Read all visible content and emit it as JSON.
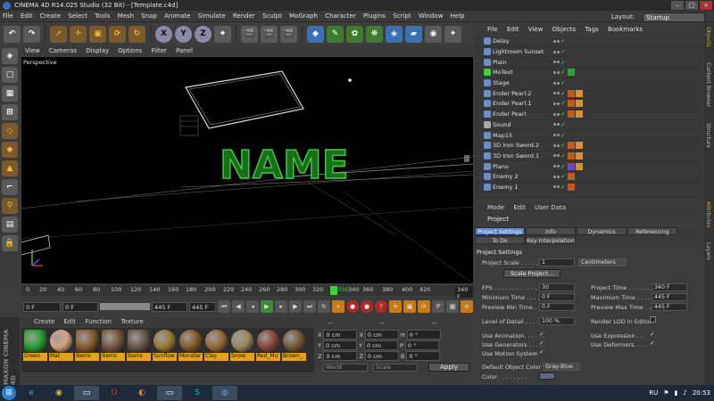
{
  "window": {
    "title": "CINEMA 4D R14.025 Studio (32 Bit) - [Template.c4d]"
  },
  "menu": [
    "File",
    "Edit",
    "Create",
    "Select",
    "Tools",
    "Mesh",
    "Snap",
    "Animate",
    "Simulate",
    "Render",
    "Sculpt",
    "MoGraph",
    "Character",
    "Plugins",
    "Script",
    "Window",
    "Help"
  ],
  "layout": {
    "label": "Layout:",
    "value": "Startup"
  },
  "toolbar": {
    "axes": [
      "X",
      "Y",
      "Z"
    ]
  },
  "viewport": {
    "menu": [
      "View",
      "Cameras",
      "Display",
      "Options",
      "Filter",
      "Panel"
    ],
    "label": "Perspective",
    "text3d": "NAME"
  },
  "timeline": {
    "ticks": [
      "0",
      "20",
      "40",
      "60",
      "80",
      "100",
      "120",
      "140",
      "160",
      "180",
      "200",
      "220",
      "240",
      "260",
      "280",
      "300",
      "320",
      "340",
      "360",
      "380",
      "400",
      "420",
      "440"
    ],
    "current": "330",
    "end_frame": "340 F"
  },
  "transport": {
    "start": "0 F",
    "current_left": "0 F",
    "current_right": "445 F",
    "end": "445 F"
  },
  "materials": {
    "menu": [
      "Create",
      "Edit",
      "Function",
      "Texture"
    ],
    "items": [
      {
        "name": "Green",
        "color": "#2fa22f"
      },
      {
        "name": "Mat",
        "color": "#d8a482"
      },
      {
        "name": "Items",
        "color": "#8a6030"
      },
      {
        "name": "Items",
        "color": "#7a5a40"
      },
      {
        "name": "Items",
        "color": "#6a5a4a"
      },
      {
        "name": "Sunflow",
        "color": "#9a7a30"
      },
      {
        "name": "Monster",
        "color": "#8a5a2a"
      },
      {
        "name": "Clay",
        "color": "#9a6a3a"
      },
      {
        "name": "Snow",
        "color": "#9a8a5a"
      },
      {
        "name": "Red_Mu",
        "color": "#8a4a3a"
      },
      {
        "name": "Brown_",
        "color": "#7a5a3a"
      }
    ]
  },
  "coordinates": {
    "header": [
      "--",
      "--",
      "--"
    ],
    "rows": [
      {
        "a": "X",
        "av": "0 cm",
        "b": "X",
        "bv": "0 cm",
        "c": "H",
        "cv": "0 °"
      },
      {
        "a": "Y",
        "av": "0 cm",
        "b": "Y",
        "bv": "0 cm",
        "c": "P",
        "cv": "0 °"
      },
      {
        "a": "Z",
        "av": "0 cm",
        "b": "Z",
        "bv": "0 cm",
        "c": "B",
        "cv": "0 °"
      }
    ],
    "mode": "World",
    "scale": "Scale",
    "apply": "Apply"
  },
  "objects": {
    "menu": [
      "File",
      "Edit",
      "View",
      "Objects",
      "Tags",
      "Bookmarks"
    ],
    "items": [
      "Delay",
      "Lightroom Sunset",
      "Plain",
      "MoText",
      "Stage",
      "Ender Pearl.2",
      "Ender Pearl.1",
      "Ender Pearl",
      "Sound",
      "Map15",
      "3D Iron Sword.2",
      "3D Iron Sword.1",
      "Plano",
      "Enemy 2",
      "Enemy 1"
    ]
  },
  "attributes": {
    "menu": [
      "Mode",
      "Edit",
      "User Data"
    ],
    "title": "Project",
    "tabs": [
      "Project Settings",
      "Info",
      "Dynamics",
      "Referencing",
      "To Do",
      "Key Interpolation"
    ],
    "section": "Project Settings",
    "scale_label": "Project Scale . . . . . . .",
    "scale_value": "1",
    "scale_unit": "Centimeters",
    "scale_button": "Scale Project...",
    "fps_label": "FPS . . . . . . . . . . . . .",
    "fps": "30",
    "ptime_label": "Project Time . . . . . . .",
    "ptime": "340 F",
    "mintime_label": "Minimum Time . . . . .",
    "mintime": "0 F",
    "maxtime_label": "Maximum Time . . . . .",
    "maxtime": "445 F",
    "pvmin_label": "Preview Min Time . .",
    "pvmin": "0 F",
    "pvmax_label": "Preview Max Time . .",
    "pvmax": "445 F",
    "lod_label": "Level of Detail . . . . .",
    "lod": "100 %",
    "renderlod_label": "Render LOD in Editor",
    "useanim_label": "Use Animation. . . . . .",
    "useexpr_label": "Use Expression . . .",
    "usegen_label": "Use Generators . . . . .",
    "usedef_label": "Use Deformers. . . .",
    "usemo_label": "Use Motion System",
    "defcolor_label": "Default Object Color",
    "defcolor": "Gray-Blue",
    "color_label": "Color . . . . . . . ."
  },
  "rightstrip": [
    "Objects",
    "Content Browser",
    "Structure",
    "Attributes",
    "Layers"
  ],
  "maxon": "MAXON CINEMA 4D",
  "taskbar": {
    "lang": "RU",
    "time": "20:53"
  }
}
